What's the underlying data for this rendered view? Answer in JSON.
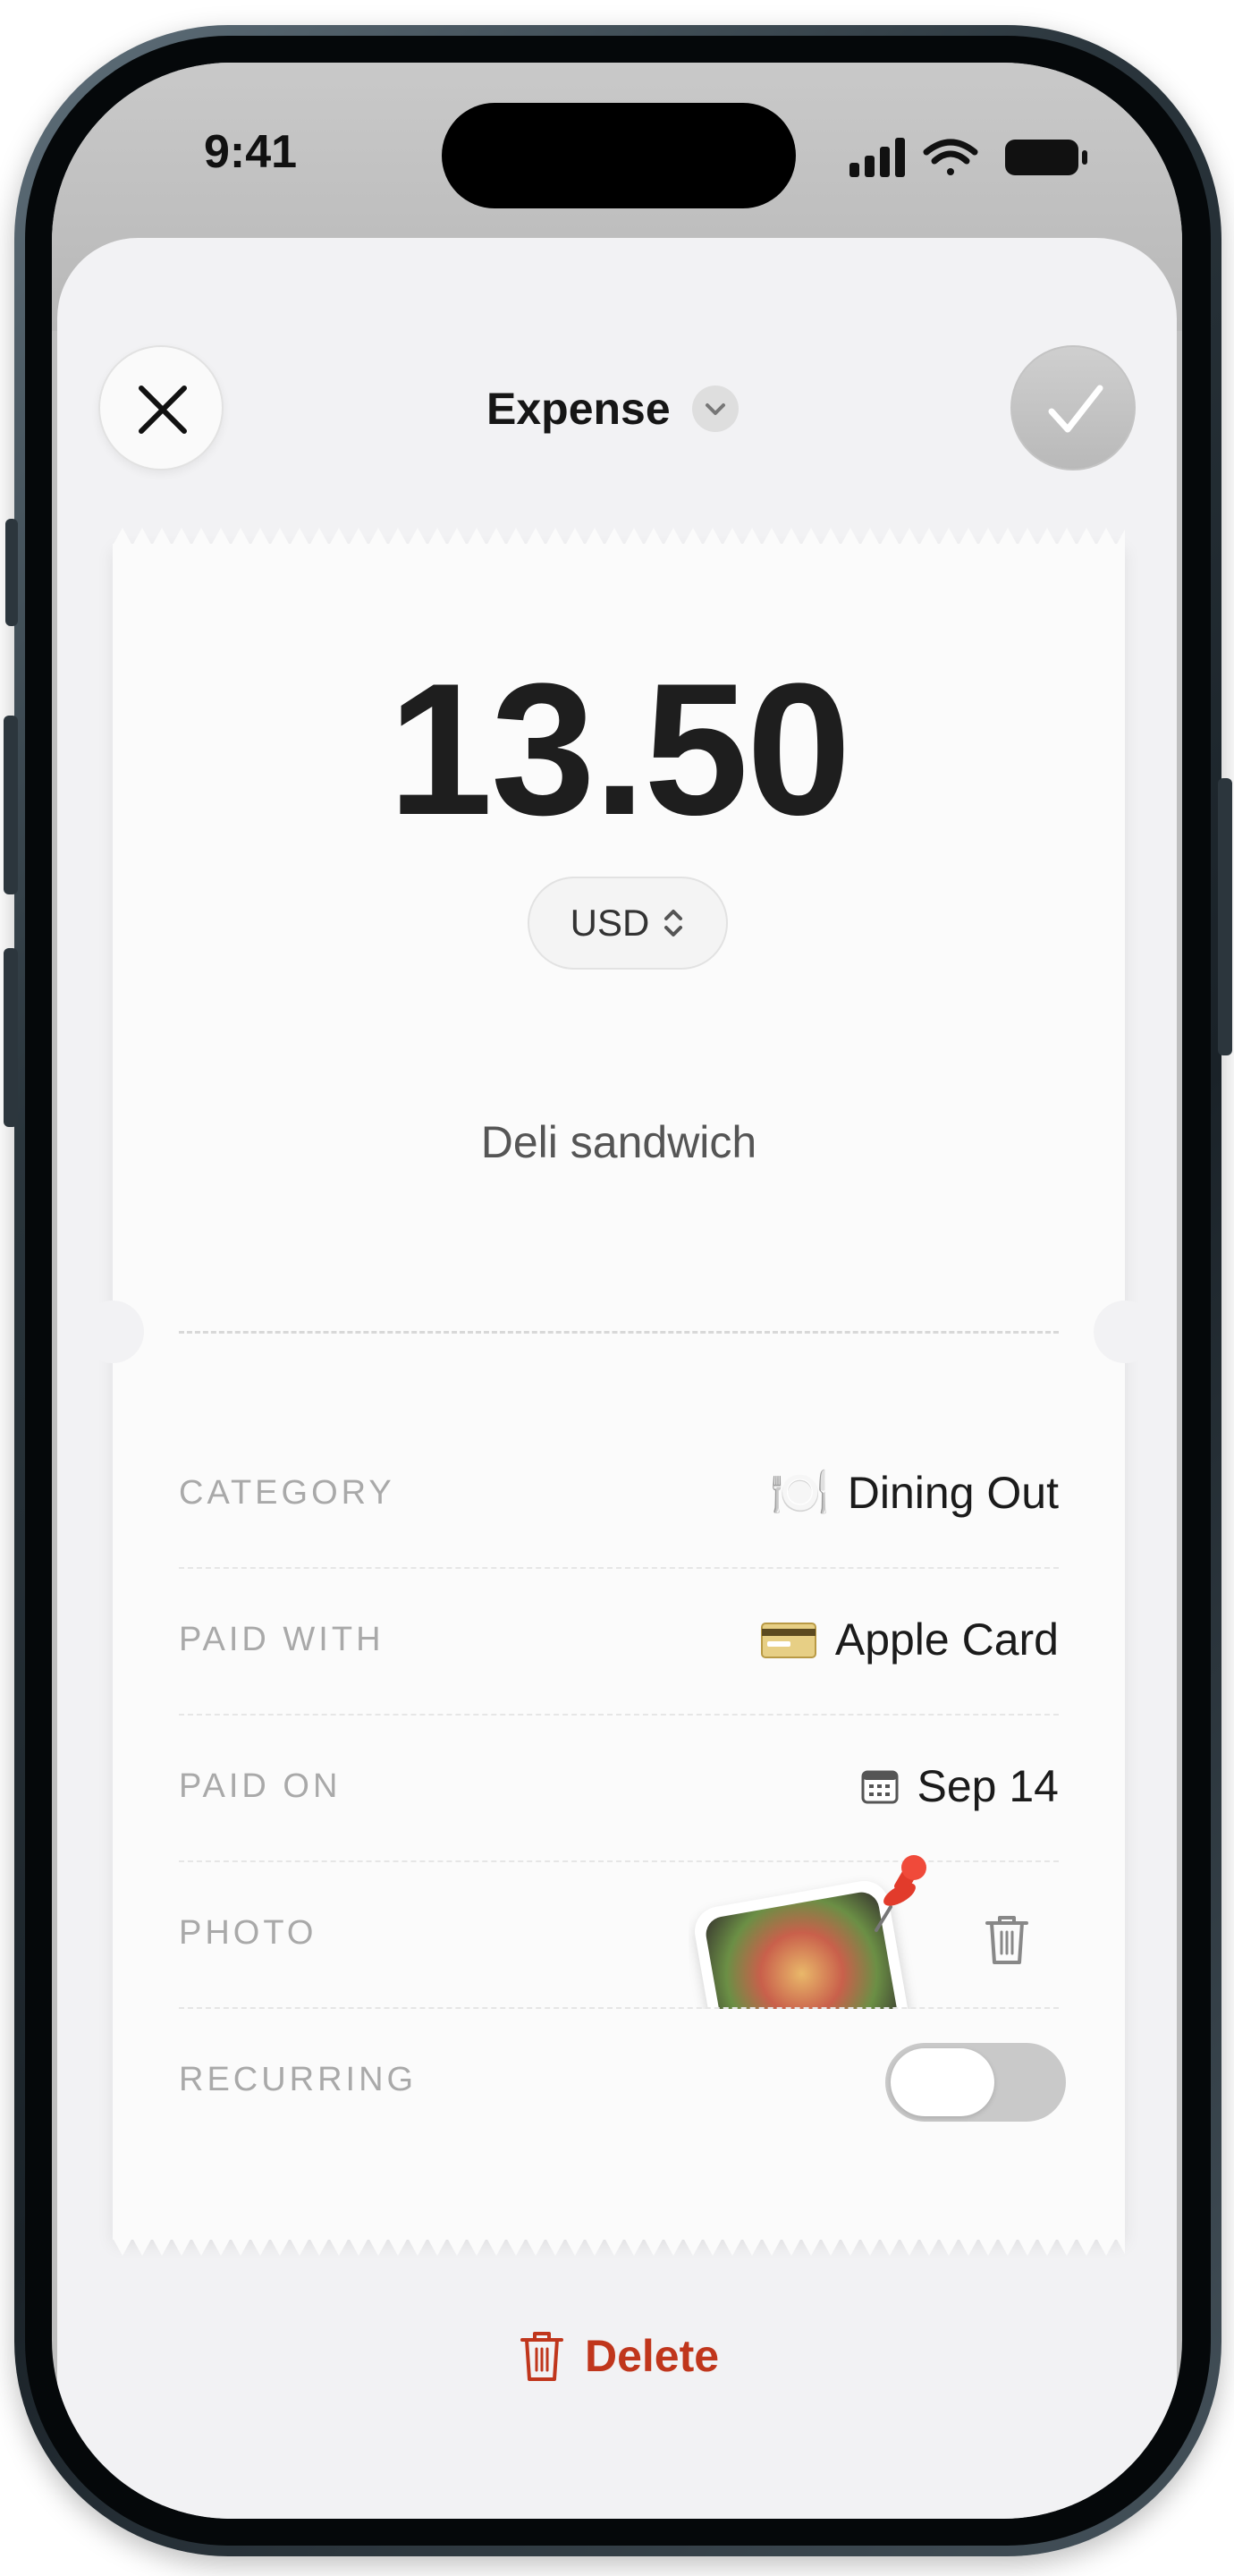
{
  "status_bar": {
    "time": "9:41"
  },
  "header": {
    "title": "Expense"
  },
  "expense": {
    "amount": "13.50",
    "currency": "USD",
    "note": "Deli sandwich"
  },
  "fields": {
    "category": {
      "label": "CATEGORY",
      "value": "Dining Out",
      "icon": "fork-knife-plate-icon"
    },
    "paid_with": {
      "label": "PAID WITH",
      "value": "Apple Card",
      "icon": "credit-card-icon"
    },
    "paid_on": {
      "label": "PAID ON",
      "value": "Sep 14",
      "icon": "calendar-icon"
    },
    "photo": {
      "label": "PHOTO",
      "icon": "pushpin-icon"
    },
    "recurring": {
      "label": "RECURRING",
      "enabled": false
    }
  },
  "actions": {
    "delete_label": "Delete"
  },
  "colors": {
    "delete": "#c0361c",
    "sheet_bg": "#f2f2f4",
    "receipt_bg": "#fbfbfb"
  }
}
